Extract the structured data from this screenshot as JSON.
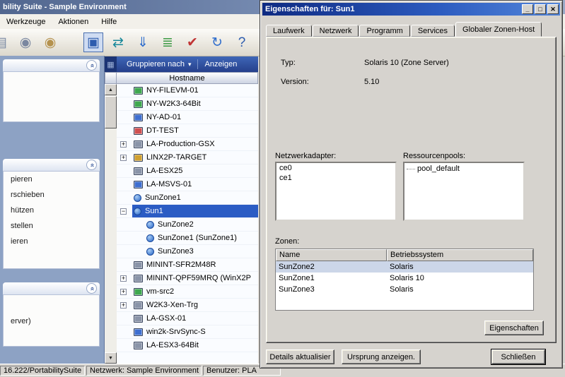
{
  "main_window": {
    "title": "bility Suite - Sample Environment",
    "menu": {
      "items": [
        "Werkzeuge",
        "Aktionen",
        "Hilfe"
      ]
    },
    "toolbar": {
      "icons": [
        {
          "name": "server-stack-icon",
          "glyph": "▤",
          "color": "#7a8aa4",
          "pressed": false
        },
        {
          "name": "cd-blue-icon",
          "glyph": "◉",
          "color": "#7a87a0",
          "pressed": false
        },
        {
          "name": "cd-gold-icon",
          "glyph": "◉",
          "color": "#b5924e",
          "pressed": false
        },
        {
          "name": "discover-monitor-icon",
          "glyph": "▣",
          "color": "#2d5cae",
          "pressed": true
        },
        {
          "name": "convert-arrows-icon",
          "glyph": "⇄",
          "color": "#18889a",
          "pressed": false
        },
        {
          "name": "import-download-icon",
          "glyph": "⇓",
          "color": "#2d6ccc",
          "pressed": false
        },
        {
          "name": "script-icon",
          "glyph": "≣",
          "color": "#3c9a44",
          "pressed": false
        },
        {
          "name": "job-check-icon",
          "glyph": "✔",
          "color": "#c03434",
          "pressed": false
        },
        {
          "name": "refresh-icon",
          "glyph": "↻",
          "color": "#2d6ccc",
          "pressed": false
        },
        {
          "name": "help-icon",
          "glyph": "?",
          "color": "#2d5cae",
          "pressed": false
        }
      ]
    },
    "task_panel": {
      "sections": [
        {
          "items": []
        },
        {
          "items": [
            "pieren",
            "rschieben",
            "hützen",
            "stellen",
            "ieren"
          ]
        },
        {
          "items": [
            "erver)"
          ]
        }
      ]
    },
    "host_list": {
      "group_by_label": "Gruppieren nach",
      "caret_glyph": "▾",
      "show_label": "Anzeigen",
      "column_header": "Hostname",
      "rows": [
        {
          "label": "NY-FILEVM-01",
          "level": 0,
          "exp": "",
          "type": "host",
          "color": "#3fa84f",
          "selected": false
        },
        {
          "label": "NY-W2K3-64Bit",
          "level": 0,
          "exp": "",
          "type": "host",
          "color": "#3fa84f",
          "selected": false
        },
        {
          "label": "NY-AD-01",
          "level": 0,
          "exp": "",
          "type": "host",
          "color": "#3f6fd0",
          "selected": false
        },
        {
          "label": "DT-TEST",
          "level": 0,
          "exp": "",
          "type": "host",
          "color": "#d05050",
          "selected": false
        },
        {
          "label": "LA-Production-GSX",
          "level": 0,
          "exp": "+",
          "type": "host",
          "color": "#8a94a8",
          "selected": false
        },
        {
          "label": "LINX2P-TARGET",
          "level": 0,
          "exp": "+",
          "type": "host",
          "color": "#d0a030",
          "selected": false
        },
        {
          "label": "LA-ESX25",
          "level": 0,
          "exp": "",
          "type": "host",
          "color": "#8a94a8",
          "selected": false
        },
        {
          "label": "LA-MSVS-01",
          "level": 0,
          "exp": "",
          "type": "host",
          "color": "#3f6fd0",
          "selected": false
        },
        {
          "label": "SunZone1",
          "level": 0,
          "exp": "",
          "type": "zone",
          "color": "",
          "selected": false
        },
        {
          "label": "Sun1",
          "level": 0,
          "exp": "−",
          "type": "zone",
          "color": "",
          "selected": true
        },
        {
          "label": "SunZone2",
          "level": 1,
          "exp": "",
          "type": "zone",
          "color": "",
          "selected": false
        },
        {
          "label": "SunZone1 (SunZone1)",
          "level": 1,
          "exp": "",
          "type": "zone",
          "color": "",
          "selected": false
        },
        {
          "label": "SunZone3",
          "level": 1,
          "exp": "",
          "type": "zone",
          "color": "",
          "selected": false
        },
        {
          "label": "MININT-SFR2M48R",
          "level": 0,
          "exp": "",
          "type": "host",
          "color": "#8a94a8",
          "selected": false
        },
        {
          "label": "MININT-QPF59MRQ (WinX2P",
          "level": 0,
          "exp": "+",
          "type": "host",
          "color": "#8a94a8",
          "selected": false
        },
        {
          "label": "vm-src2",
          "level": 0,
          "exp": "+",
          "type": "host",
          "color": "#3fa84f",
          "selected": false
        },
        {
          "label": "W2K3-Xen-Trg",
          "level": 0,
          "exp": "+",
          "type": "host",
          "color": "#8a94a8",
          "selected": false
        },
        {
          "label": "LA-GSX-01",
          "level": 0,
          "exp": "",
          "type": "host",
          "color": "#8a94a8",
          "selected": false
        },
        {
          "label": "win2k-SrvSync-S",
          "level": 0,
          "exp": "",
          "type": "host",
          "color": "#3f6fd0",
          "selected": false
        },
        {
          "label": "LA-ESX3-64Bit",
          "level": 0,
          "exp": "",
          "type": "host",
          "color": "#8a94a8",
          "selected": false
        }
      ]
    }
  },
  "dialog": {
    "title": "Eigenschaften für: Sun1",
    "window_buttons": [
      {
        "name": "minimize-button",
        "glyph": "_"
      },
      {
        "name": "maximize-button",
        "glyph": "□"
      },
      {
        "name": "close-button",
        "glyph": "✕"
      }
    ],
    "tabs": [
      {
        "label": "Laufwerk",
        "active": false
      },
      {
        "label": "Netzwerk",
        "active": false
      },
      {
        "label": "Programm",
        "active": false
      },
      {
        "label": "Services",
        "active": false
      },
      {
        "label": "Globaler Zonen-Host",
        "active": true
      }
    ],
    "tab_scroll_glyph": "►",
    "fields": {
      "type_label": "Typ:",
      "type_value": "Solaris 10 (Zone Server)",
      "version_label": "Version:",
      "version_value": "5.10"
    },
    "adapters": {
      "label": "Netzwerkadapter:",
      "items": [
        "ce0",
        "ce1"
      ]
    },
    "pools": {
      "label": "Ressourcenpools:",
      "items": [
        "pool_default"
      ]
    },
    "zones": {
      "label": "Zonen:",
      "columns": [
        "Name",
        "Betriebssystem"
      ],
      "rows": [
        [
          "SunZone2",
          "Solaris"
        ],
        [
          "SunZone1",
          "Solaris 10"
        ],
        [
          "SunZone3",
          "Solaris"
        ]
      ],
      "selected_index": 0
    },
    "properties_button": "Eigenschaften",
    "buttons": {
      "details": "Details aktualisier",
      "origin": "Ursprung anzeigen.",
      "close": "Schließen"
    }
  },
  "status_bar": {
    "segments": [
      "16.222/PortabilitySuite",
      "Netzwerk: Sample Environment",
      "Benutzer: PLA"
    ]
  }
}
